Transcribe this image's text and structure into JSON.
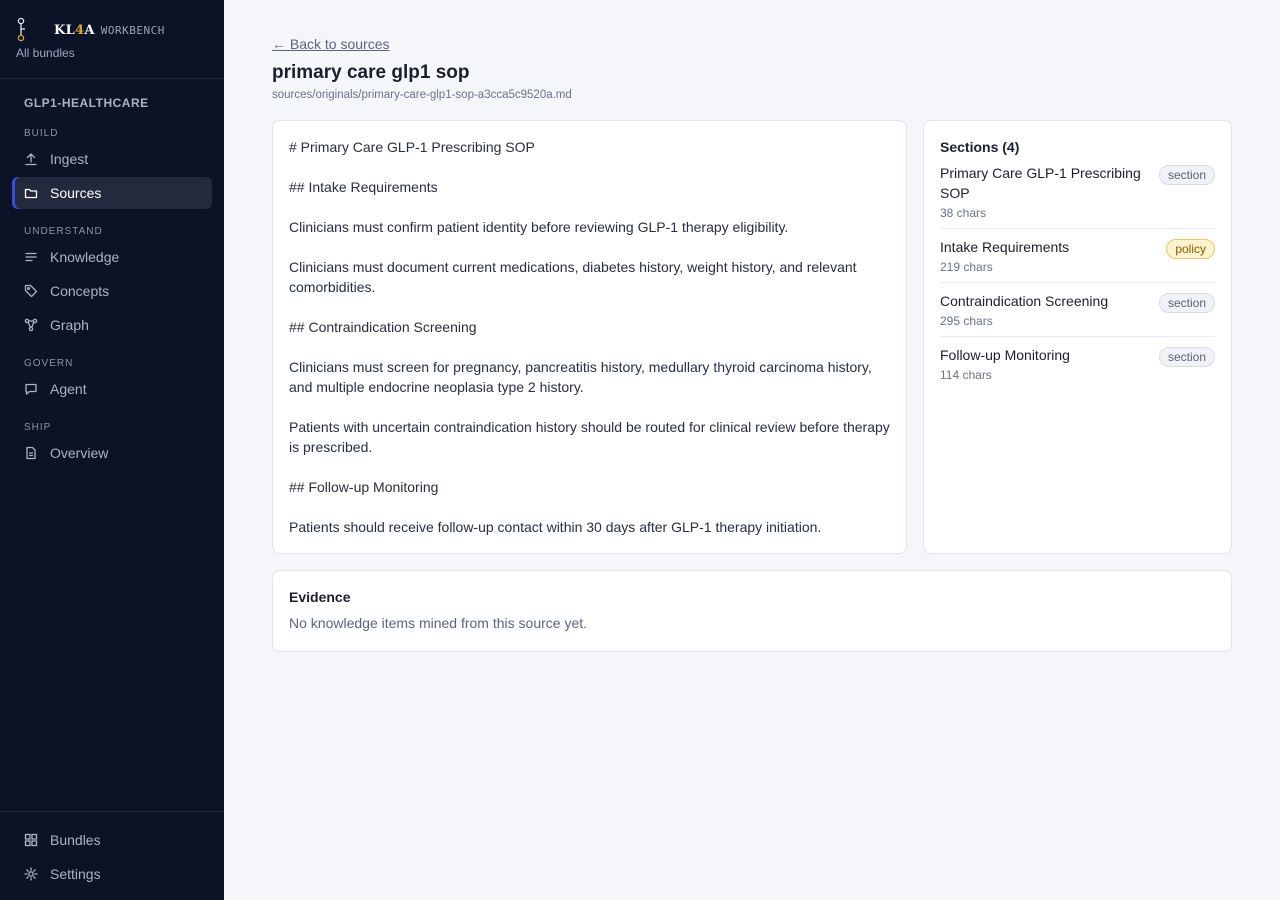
{
  "brand": {
    "name_prefix": "KL",
    "name_four": "4",
    "name_suffix": "A",
    "subtitle": "WORKBENCH",
    "all_bundles": "All bundles"
  },
  "sidebar": {
    "bundle_name": "GLP1-HEALTHCARE",
    "groups": [
      {
        "label": "BUILD",
        "items": [
          {
            "label": "Ingest",
            "icon": "upload-icon"
          },
          {
            "label": "Sources",
            "icon": "folder-icon",
            "active": true
          }
        ]
      },
      {
        "label": "UNDERSTAND",
        "items": [
          {
            "label": "Knowledge",
            "icon": "list-icon"
          },
          {
            "label": "Concepts",
            "icon": "tag-icon"
          },
          {
            "label": "Graph",
            "icon": "graph-icon"
          }
        ]
      },
      {
        "label": "GOVERN",
        "items": [
          {
            "label": "Agent",
            "icon": "chat-icon"
          }
        ]
      },
      {
        "label": "SHIP",
        "items": [
          {
            "label": "Overview",
            "icon": "document-icon"
          }
        ]
      }
    ],
    "bottom": [
      {
        "label": "Bundles",
        "icon": "grid-icon"
      },
      {
        "label": "Settings",
        "icon": "gear-icon"
      }
    ]
  },
  "main": {
    "back_link": "← Back to sources",
    "title": "primary care glp1 sop",
    "path": "sources/originals/primary-care-glp1-sop-a3cca5c9520a.md",
    "document_lines": [
      "# Primary Care GLP-1 Prescribing SOP",
      "",
      "## Intake Requirements",
      "",
      "Clinicians must confirm patient identity before reviewing GLP-1 therapy eligibility.",
      "",
      "Clinicians must document current medications, diabetes history, weight history, and relevant",
      "comorbidities.",
      "",
      "## Contraindication Screening",
      "",
      "Clinicians must screen for pregnancy, pancreatitis history, medullary thyroid carcinoma history,",
      "and multiple endocrine neoplasia type 2 history.",
      "",
      "Patients with uncertain contraindication history should be routed for clinical review before therapy",
      "is prescribed.",
      "",
      "## Follow-up Monitoring",
      "",
      "Patients should receive follow-up contact within 30 days after GLP-1 therapy initiation."
    ],
    "sections": {
      "title": "Sections (4)",
      "items": [
        {
          "name": "Primary Care GLP-1 Prescribing SOP",
          "chars": "38 chars",
          "badge": "section"
        },
        {
          "name": "Intake Requirements",
          "chars": "219 chars",
          "badge": "policy"
        },
        {
          "name": "Contraindication Screening",
          "chars": "295 chars",
          "badge": "section"
        },
        {
          "name": "Follow-up Monitoring",
          "chars": "114 chars",
          "badge": "section"
        }
      ]
    },
    "evidence": {
      "title": "Evidence",
      "empty_text": "No knowledge items mined from this source yet."
    }
  },
  "colors": {
    "sidebar_bg": "#0d1326",
    "accent": "#3b4fd4",
    "brand_gold": "#e0a63a",
    "policy_badge_bg": "#fdf3cf"
  }
}
